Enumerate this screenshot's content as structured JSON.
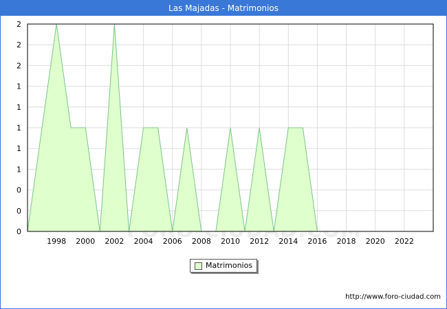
{
  "window": {
    "title": "Las Majadas - Matrimonios"
  },
  "watermark": "FORO-CIUDAD.COM",
  "source": "http://www.foro-ciudad.com",
  "colors": {
    "accent": "#3a78d8",
    "area_fill": "#dfffcc",
    "area_line": "#7cc48c"
  },
  "chart_data": {
    "type": "area",
    "title": "Las Majadas - Matrimonios",
    "xlabel": "",
    "ylabel": "",
    "x": [
      1996,
      1997,
      1998,
      1999,
      2000,
      2001,
      2002,
      2003,
      2004,
      2005,
      2006,
      2007,
      2008,
      2009,
      2010,
      2011,
      2012,
      2013,
      2014,
      2015,
      2016,
      2017,
      2018,
      2019,
      2020,
      2021,
      2022,
      2023
    ],
    "series": [
      {
        "name": "Matrimonios",
        "values": [
          0,
          1,
          2,
          1,
          1,
          0,
          2,
          0,
          1,
          1,
          0,
          1,
          0,
          0,
          1,
          0,
          1,
          0,
          1,
          1,
          0,
          0,
          0,
          0,
          0,
          0,
          0,
          0
        ]
      }
    ],
    "xlim": [
      1996,
      2024
    ],
    "ylim": [
      0,
      2
    ],
    "xticks": [
      1998,
      2000,
      2002,
      2004,
      2006,
      2008,
      2010,
      2012,
      2014,
      2016,
      2018,
      2020,
      2022
    ],
    "yticks": [
      0,
      0.2,
      0.4,
      0.6,
      0.8,
      1.0,
      1.2,
      1.4,
      1.6,
      1.8,
      2.0
    ],
    "ytick_labels": [
      "0",
      "0",
      "0",
      "1",
      "1",
      "1",
      "1",
      "1",
      "2",
      "2",
      "2"
    ],
    "grid": true,
    "legend": {
      "placement": "bottom-center",
      "entries": [
        "Matrimonios"
      ]
    }
  }
}
